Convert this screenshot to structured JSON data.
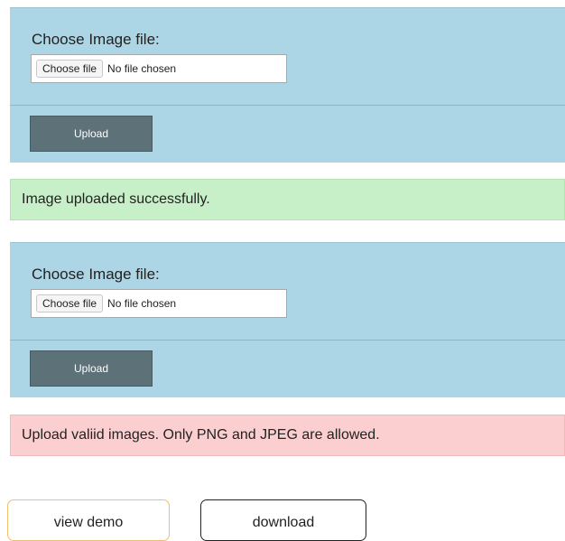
{
  "forms": [
    {
      "label": "Choose Image file:",
      "choose_button": "Choose file",
      "file_status": "No file chosen",
      "upload_button": "Upload"
    },
    {
      "label": "Choose Image file:",
      "choose_button": "Choose file",
      "file_status": "No file chosen",
      "upload_button": "Upload"
    }
  ],
  "messages": {
    "success": "Image uploaded successfully.",
    "error": "Upload valiid images. Only PNG and JPEG are allowed."
  },
  "links": {
    "view_demo": "view demo",
    "download": "download"
  },
  "colors": {
    "form_bg": "#acd6e6",
    "upload_button_bg": "#5d7179",
    "success_bg": "#c8f0c8",
    "error_bg": "#fbcfd0",
    "view_demo_border": "#f0c06a"
  }
}
